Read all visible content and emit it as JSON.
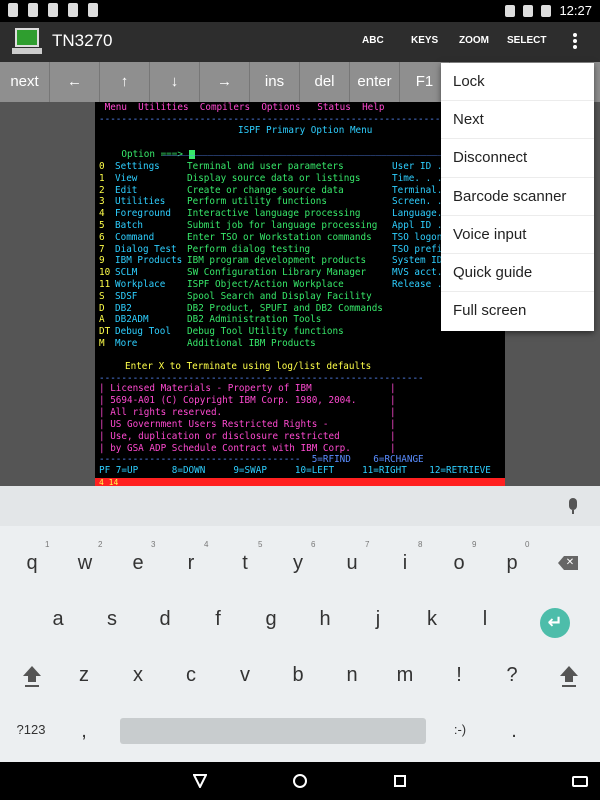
{
  "status_bar": {
    "time": "12:27"
  },
  "app": {
    "title": "TN3270",
    "actions": [
      "ABC",
      "KEYS",
      "ZOOM",
      "SELECT"
    ]
  },
  "keyrow": [
    "next",
    "←",
    "↑",
    "↓",
    "→",
    "ins",
    "del",
    "enter",
    "F1"
  ],
  "menu": [
    "Lock",
    "Next",
    "Disconnect",
    "Barcode scanner",
    "Voice input",
    "Quick guide",
    "Full screen"
  ],
  "terminal": {
    "menubar": " Menu  Utilities  Compilers  Options   Status  Help",
    "rule": "------------------------------------------------------------------------",
    "title": "ISPF Primary Option Menu",
    "option_prompt": "Option ===> ",
    "options": [
      {
        "key": "0",
        "name": "Settings",
        "desc": "Terminal and user parameters",
        "side": "User ID ."
      },
      {
        "key": "1",
        "name": "View",
        "desc": "Display source data or listings",
        "side": "Time. . ."
      },
      {
        "key": "2",
        "name": "Edit",
        "desc": "Create or change source data",
        "side": "Terminal."
      },
      {
        "key": "3",
        "name": "Utilities",
        "desc": "Perform utility functions",
        "side": "Screen. ."
      },
      {
        "key": "4",
        "name": "Foreground",
        "desc": "Interactive language processing",
        "side": "Language."
      },
      {
        "key": "5",
        "name": "Batch",
        "desc": "Submit job for language processing",
        "side": "Appl ID ."
      },
      {
        "key": "6",
        "name": "Command",
        "desc": "Enter TSO or Workstation commands",
        "side": "TSO logon"
      },
      {
        "key": "7",
        "name": "Dialog Test",
        "desc": "Perform dialog testing",
        "side": "TSO prefi"
      },
      {
        "key": "9",
        "name": "IBM Products",
        "desc": "IBM program development products",
        "side": "System ID"
      },
      {
        "key": "10",
        "name": "SCLM",
        "desc": "SW Configuration Library Manager",
        "side": "MVS acct."
      },
      {
        "key": "11",
        "name": "Workplace",
        "desc": "ISPF Object/Action Workplace",
        "side": "Release ."
      },
      {
        "key": "S",
        "name": "SDSF",
        "desc": "Spool Search and Display Facility",
        "side": ""
      },
      {
        "key": "D",
        "name": "DB2",
        "desc": "DB2 Product, SPUFI and DB2 Commands",
        "side": ""
      },
      {
        "key": "A",
        "name": "DB2ADM",
        "desc": "DB2 Administration Tools",
        "side": ""
      },
      {
        "key": "DT",
        "name": "Debug Tool",
        "desc": "Debug Tool Utility functions",
        "side": ""
      },
      {
        "key": "M",
        "name": "More",
        "desc": "Additional IBM Products",
        "side": ""
      }
    ],
    "terminate": "Enter X to Terminate using log/list defaults",
    "license": [
      "| Licensed Materials - Property of IBM              |",
      "| 5694-A01 (C) Copyright IBM Corp. 1980, 2004.      |",
      "| All rights reserved.                              |",
      "| US Government Users Restricted Rights -           |",
      "| Use, duplication or disclosure restricted         |",
      "| by GSA ADP Schedule Contract with IBM Corp.       |"
    ],
    "pf_line1": "------------------------------------  5=RFIND    6=RCHANGE",
    "pf_line2": "PF 7=UP      8=DOWN     9=SWAP     10=LEFT     11=RIGHT    12=RETRIEVE",
    "status_line": "4 14"
  },
  "keyboard": {
    "row1": [
      "q",
      "w",
      "e",
      "r",
      "t",
      "y",
      "u",
      "i",
      "o",
      "p"
    ],
    "row1_hints": [
      "1",
      "2",
      "3",
      "4",
      "5",
      "6",
      "7",
      "8",
      "9",
      "0"
    ],
    "row2": [
      "a",
      "s",
      "d",
      "f",
      "g",
      "h",
      "j",
      "k",
      "l"
    ],
    "row3": [
      "z",
      "x",
      "c",
      "v",
      "b",
      "n",
      "m",
      "!",
      "?"
    ],
    "symbols_key": "?123",
    "comma": ",",
    "emoji": ":-)",
    "period": "."
  }
}
